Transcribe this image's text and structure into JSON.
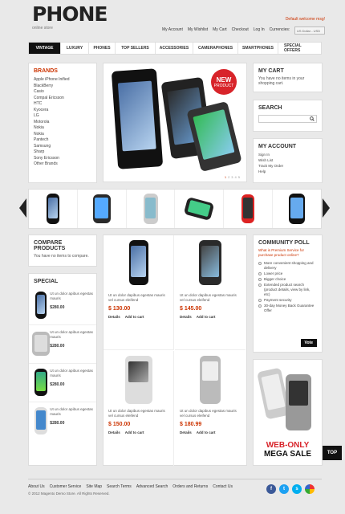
{
  "header": {
    "title": "PHONE",
    "subtitle": "online store",
    "welcome": "Default welcome msg!",
    "links": [
      "My Account",
      "My Wishlist",
      "My Cart",
      "Checkout",
      "Log In",
      "Currencies:"
    ],
    "currency_select": "US Dollar - USD"
  },
  "nav": [
    "Vintage",
    "Luxury",
    "Phones",
    "Top sellers",
    "Accessories",
    "Cameraphones",
    "Smartphones",
    "Special offers"
  ],
  "brands": {
    "title": "Brands",
    "items": [
      "Apple iPhone Inified",
      "BlackBerry",
      "Casio",
      "Compal Ericsson",
      "HTC",
      "Kyocera",
      "LG",
      "Motorola",
      "Nokia",
      "Nokia",
      "Pantech",
      "Samsung",
      "Sharp",
      "Sony Ericsson",
      "Other Brands"
    ]
  },
  "slider": {
    "badge_line1": "NEW",
    "badge_line2": "PRODUCT",
    "pager": [
      "1",
      "2",
      "3",
      "4",
      "5"
    ]
  },
  "cart": {
    "title": "My Cart",
    "text": "You have no items in your shopping cart."
  },
  "search": {
    "title": "Search",
    "placeholder": ""
  },
  "account": {
    "title": "My Account",
    "items": [
      "Sign In",
      "Wish List",
      "Track My Order",
      "Help"
    ]
  },
  "compare": {
    "title": "Compare Products",
    "text": "You have no items to compare."
  },
  "special": {
    "title": "Special",
    "items": [
      {
        "text": "Ut un dolor apibus egestas mauris",
        "price": "$280.00"
      },
      {
        "text": "Ut un dolor apibus egestas mauris",
        "price": "$280.00"
      },
      {
        "text": "Ut un dolor apibus egestas mauris",
        "price": "$280.00"
      },
      {
        "text": "Ut un dolor apibus egestas mauris",
        "price": "$280.00"
      }
    ]
  },
  "products": [
    {
      "desc": "Ut un dolor dapibus egestas mauris vel cursus eleifend",
      "price": "$ 130.00",
      "details": "Details",
      "add": "Add to cart"
    },
    {
      "desc": "Ut un dolor dapibus egestas mauris vel cursus eleifend",
      "price": "$ 145.00",
      "details": "Details",
      "add": "Add to cart"
    },
    {
      "desc": "Ut un dolor dapibus egestas mauris vel cursus eleifend",
      "price": "$ 150.00",
      "details": "Details",
      "add": "Add to cart"
    },
    {
      "desc": "Ut un dolor dapibus egestas mauris vel cursus eleifend",
      "price": "$ 180.99",
      "details": "Details",
      "add": "Add to cart"
    }
  ],
  "poll": {
    "title": "Community Poll",
    "question": "What is Premium Service for purchase product online?",
    "options": [
      "More convenient shopping and delivery",
      "Lower price",
      "Bigger choice",
      "Extended product search (product details, view by link, etc)",
      "Payment security",
      "30-day Money Back Guarantee Offer"
    ],
    "vote": "Vote"
  },
  "sale": {
    "line1": "WEB-ONLY",
    "line2": "MEGA SALE"
  },
  "top_button": "TOP",
  "footer": {
    "links": [
      "About Us",
      "Customer Service",
      "Site Map",
      "Search Terms",
      "Advanced Search",
      "Orders and Returns",
      "Contact Us"
    ],
    "copyright": "© 2012 Magento Demo Store. All Rights Reserved."
  },
  "colors": {
    "accent": "#cc3300",
    "badge": "#d8242a",
    "nav_active": "#111111"
  }
}
